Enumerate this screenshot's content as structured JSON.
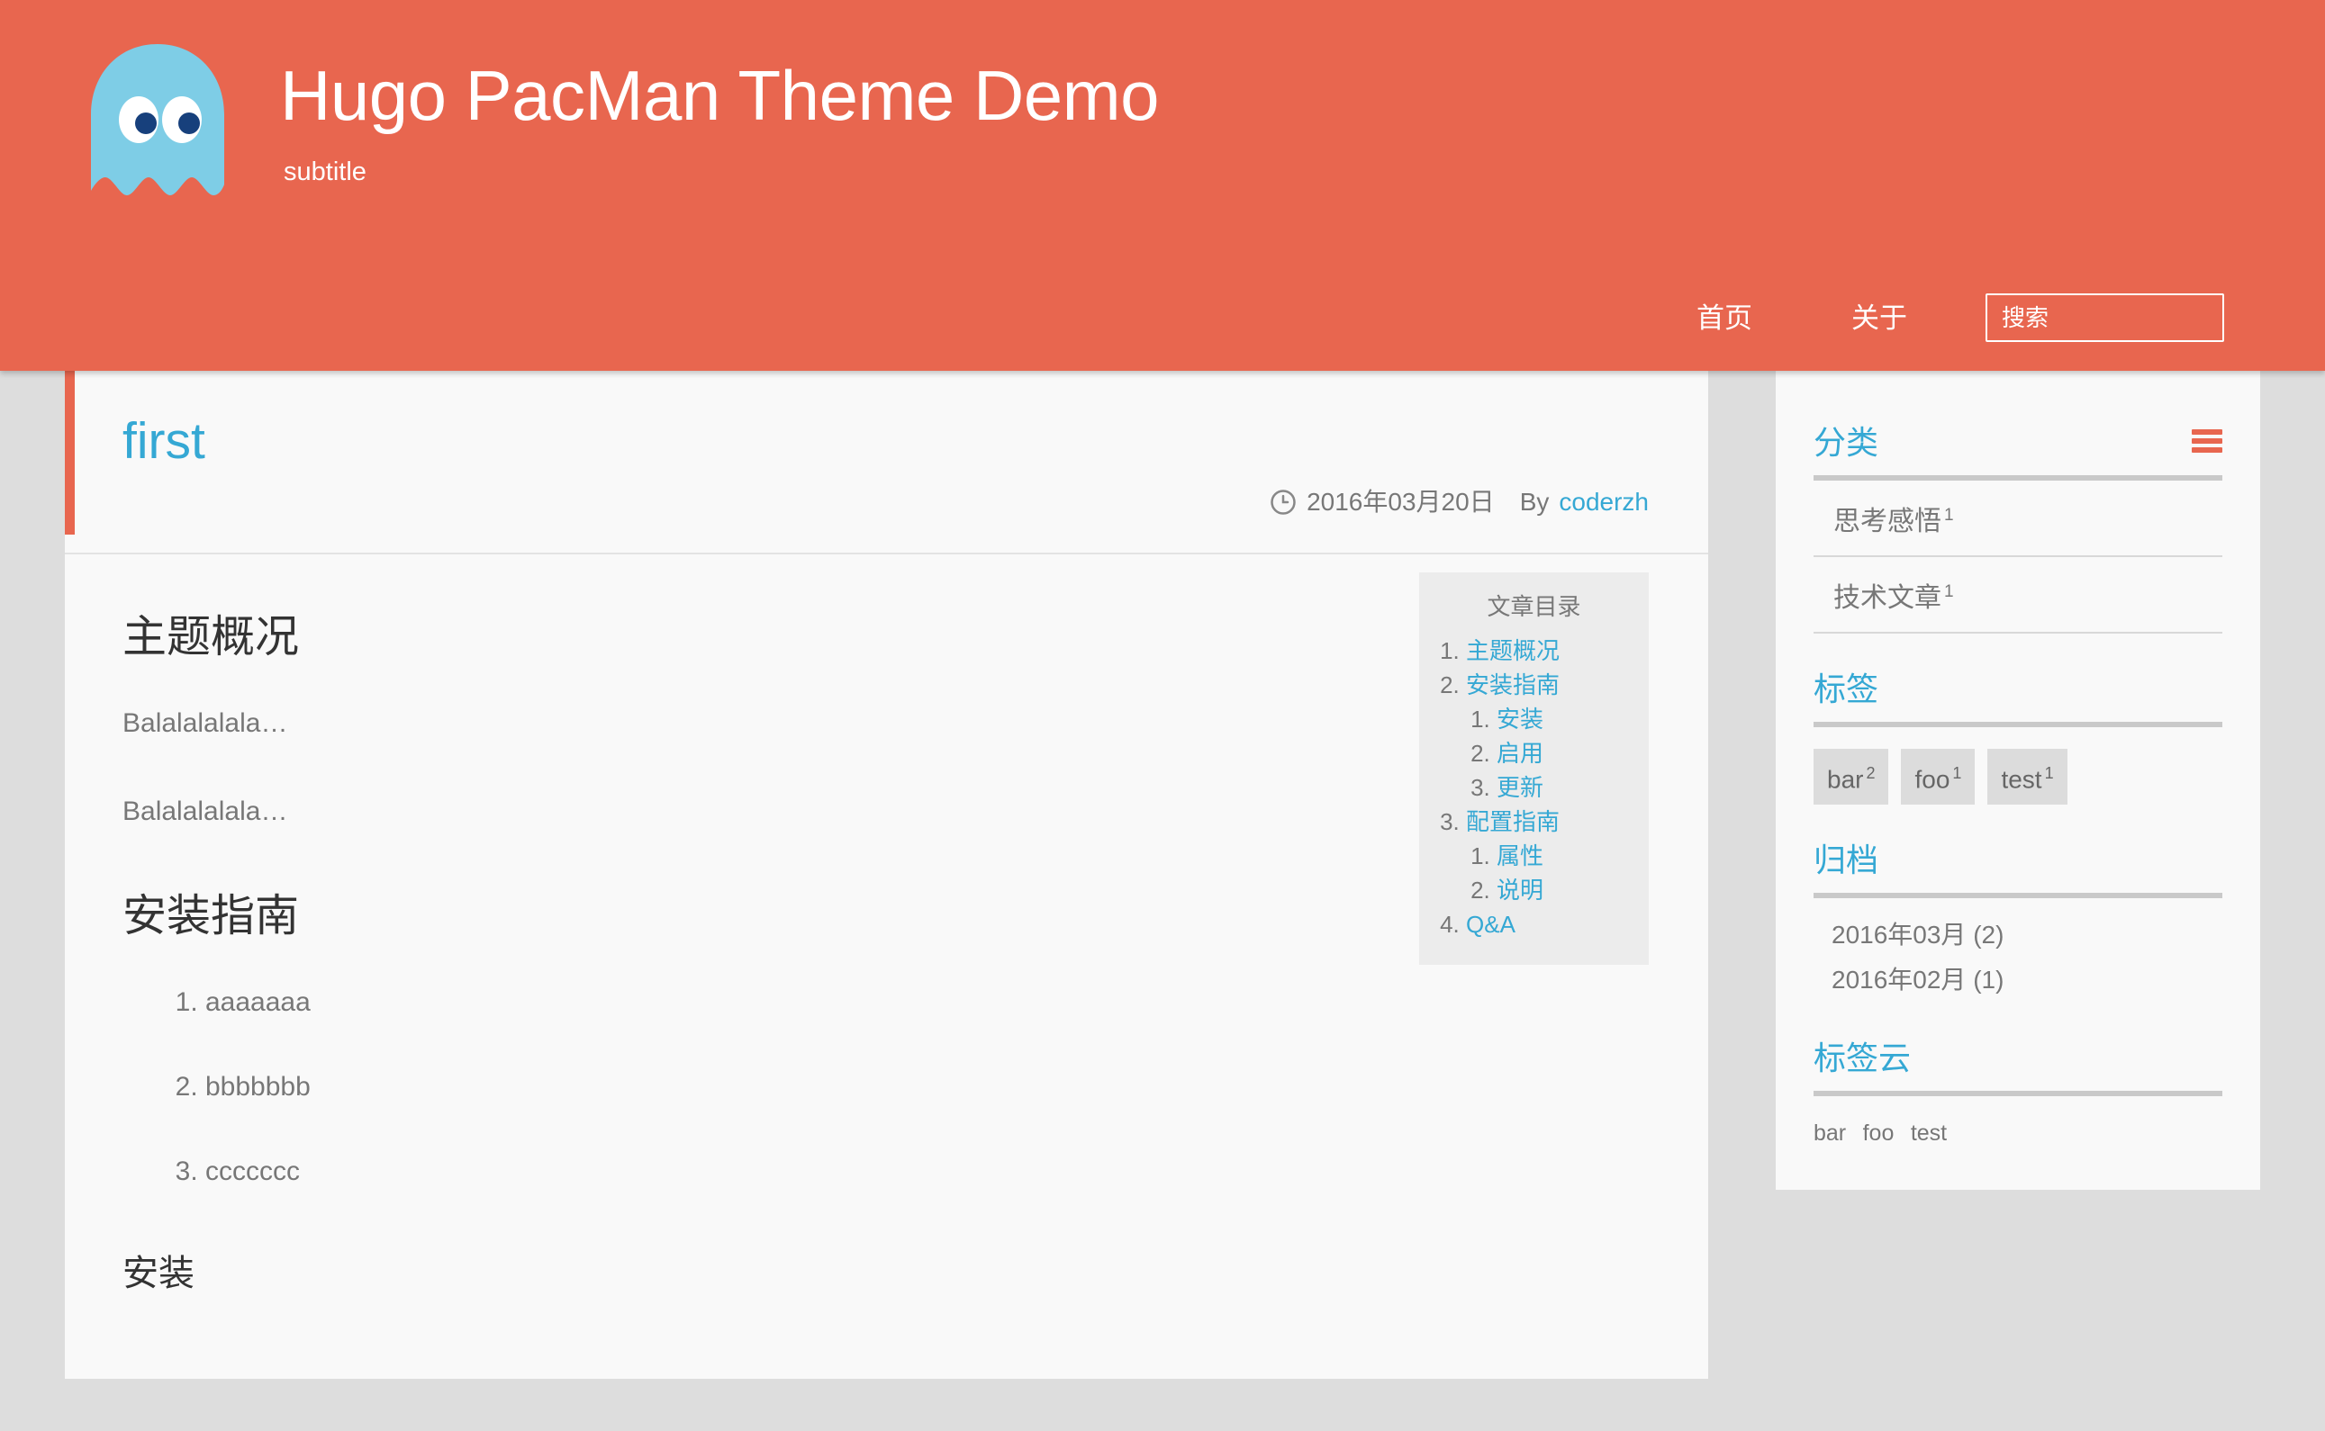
{
  "header": {
    "title": "Hugo PacMan Theme Demo",
    "subtitle": "subtitle",
    "logo_icon": "ghost-icon",
    "accent_color": "#e8664f",
    "nav": [
      {
        "label": "首页"
      },
      {
        "label": "关于"
      }
    ],
    "search": {
      "placeholder": "搜索",
      "value": ""
    }
  },
  "article": {
    "title": "first",
    "date": "2016年03月20日",
    "by_label": "By",
    "author": "coderzh",
    "date_icon": "clock-icon",
    "link_color": "#35a8d4",
    "sections": {
      "h2_overview": "主题概况",
      "p1": "Balalalalala…",
      "p2": "Balalalalala…",
      "h2_install_guide": "安装指南",
      "list": [
        "aaaaaaa",
        "bbbbbbb",
        "ccccccc"
      ],
      "h3_install": "安装"
    }
  },
  "toc": {
    "title": "文章目录",
    "items": [
      {
        "label": "主题概况",
        "children": []
      },
      {
        "label": "安装指南",
        "children": [
          {
            "label": "安装"
          },
          {
            "label": "启用"
          },
          {
            "label": "更新"
          }
        ]
      },
      {
        "label": "配置指南",
        "children": [
          {
            "label": "属性"
          },
          {
            "label": "说明"
          }
        ]
      },
      {
        "label": "Q&A",
        "children": []
      }
    ]
  },
  "sidebar": {
    "categories": {
      "title": "分类",
      "menu_icon": "hamburger-icon",
      "items": [
        {
          "label": "思考感悟",
          "count": "1"
        },
        {
          "label": "技术文章",
          "count": "1"
        }
      ]
    },
    "tags": {
      "title": "标签",
      "items": [
        {
          "label": "bar",
          "count": "2"
        },
        {
          "label": "foo",
          "count": "1"
        },
        {
          "label": "test",
          "count": "1"
        }
      ]
    },
    "archives": {
      "title": "归档",
      "items": [
        {
          "label": "2016年03月 (2)"
        },
        {
          "label": "2016年02月 (1)"
        }
      ]
    },
    "tag_cloud": {
      "title": "标签云",
      "items": [
        {
          "label": "bar"
        },
        {
          "label": "foo"
        },
        {
          "label": "test"
        }
      ]
    }
  }
}
